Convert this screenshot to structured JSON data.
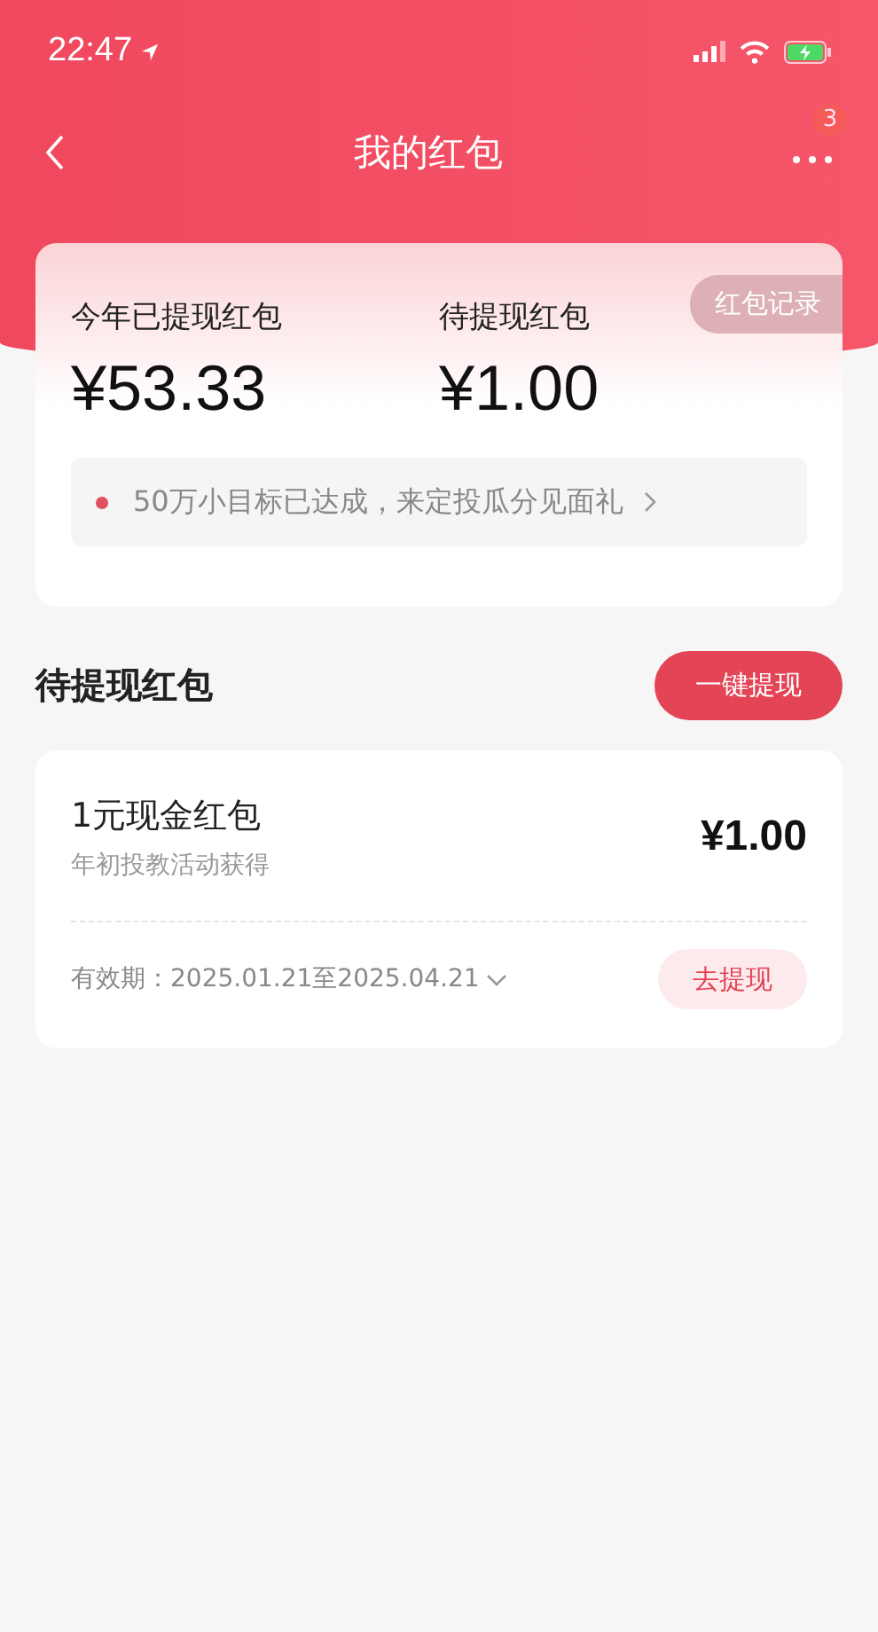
{
  "status_bar": {
    "time": "22:47"
  },
  "nav": {
    "title": "我的红包",
    "badge": "3"
  },
  "summary": {
    "stats": [
      {
        "label": "今年已提现红包",
        "amount": "¥53.33"
      },
      {
        "label": "待提现红包",
        "amount": "¥1.00"
      }
    ],
    "record_button": "红包记录",
    "notice": "50万小目标已达成，来定投瓜分见面礼"
  },
  "section": {
    "title": "待提现红包",
    "button": "一键提现"
  },
  "packets": [
    {
      "name": "1元现金红包",
      "source": "年初投教活动获得",
      "amount": "¥1.00",
      "validity": "有效期：2025.01.21至2025.04.21",
      "button": "去提现"
    }
  ]
}
